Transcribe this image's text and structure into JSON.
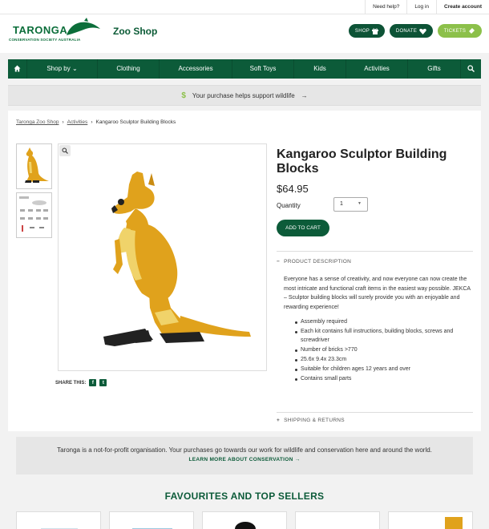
{
  "top_links": [
    "Need help?",
    "Log in",
    "Create account"
  ],
  "logo": {
    "word": "TARONGA",
    "sub": "CONSERVATION SOCIETY AUSTRALIA"
  },
  "zoo_shop": "Zoo Shop",
  "header_buttons": {
    "shop": "SHOP",
    "donate": "DONATE",
    "tickets": "TICKETS"
  },
  "nav": [
    "Shop by",
    "Clothing",
    "Accessories",
    "Soft Toys",
    "Kids",
    "Activities",
    "Gifts"
  ],
  "support_banner": "Your purchase helps support wildlife",
  "breadcrumbs": [
    "Taronga Zoo Shop",
    "Activities",
    "Kangaroo Sculptor Building Blocks"
  ],
  "product": {
    "title": "Kangaroo Sculptor Building Blocks",
    "price": "$64.95",
    "quantity_label": "Quantity",
    "quantity_value": "1",
    "add_to_cart": "ADD TO CART",
    "description_heading": "PRODUCT DESCRIPTION",
    "description": "Everyone has a sense of creativity, and now everyone can now create the most intricate and functional craft items in the easiest way possible. JEKCA – Sculptor building blocks will surely provide you with an enjoyable and rewarding experience!",
    "features": [
      "Assembly required",
      "Each kit contains full instructions, building blocks, screws and screwdriver",
      "Number of bricks >770",
      "25.6x 9.4x 23.3cm",
      "Suitable for children ages 12 years and over",
      "Contains small parts"
    ],
    "shipping_heading": "SHIPPING & RETURNS",
    "share_label": "SHARE THIS:"
  },
  "notfor": {
    "text": "Taronga is a not-for-profit organisation. Your purchases go towards our work for wildlife and conservation here and around the world.",
    "link": "LEARN MORE ABOUT CONSERVATION"
  },
  "favourites_heading": "FAVOURITES AND TOP SELLERS",
  "colors": {
    "primary": "#0c5b39",
    "accent": "#8cc04a",
    "kangaroo": "#e0a21c"
  }
}
